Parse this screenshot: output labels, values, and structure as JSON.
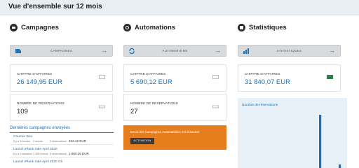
{
  "header": {
    "title": "Vue d'ensemble sur 12 mois"
  },
  "campagnes": {
    "title": "Campagnes",
    "button_label": "CAMPAGNES",
    "revenue": {
      "label": "CHIFFRE D'AFFAIRES",
      "value": "26 149,95 EUR"
    },
    "bookings": {
      "label": "NOMBRE DE RÉSERVATIONS",
      "value": "109"
    },
    "recent": {
      "title": "Dernières campagnes envoyées",
      "rows": [
        {
          "name": "Courrier Beo",
          "age": "Il y a 3 heures",
          "sent": "2 envois",
          "reservations": "3 réservations",
          "amount": "452,22 EUR"
        },
        {
          "name": "Launch Plank Sale April 2020",
          "age": "Il y a 1 semaine",
          "sent": "1 355 envois",
          "reservations": "3 réservations",
          "amount": "1 860,36 EUR"
        },
        {
          "name": "Launch Plank Sale April 2020 Gli",
          "age": "",
          "sent": "",
          "reservations": "",
          "amount": ""
        }
      ]
    }
  },
  "automations": {
    "title": "Automations",
    "button_label": "AUTOMATIONS",
    "revenue": {
      "label": "CHIFFRE D'AFFAIRES",
      "value": "5 690,12 EUR"
    },
    "bookings": {
      "label": "NOMBRE DE RÉSERVATIONS",
      "value": "27"
    },
    "banner": {
      "text": "Envoi des Campagnes Automatisées est désactivé",
      "button_label": "ACTIVATION"
    }
  },
  "statistiques": {
    "title": "Statistiques",
    "button_label": "STATISTIQUES",
    "revenue": {
      "label": "CHIFFRE D'AFFAIRES",
      "value": "31 840,07 EUR"
    },
    "chart_title": "Nombre de réservations"
  },
  "chart_data": {
    "type": "bar",
    "title": "Nombre de réservations",
    "values": [
      0,
      0,
      0,
      0,
      0,
      0,
      0,
      0,
      0,
      0,
      0,
      0,
      0,
      0,
      0,
      0,
      0,
      0,
      0,
      0,
      0,
      0,
      0,
      0,
      0,
      0,
      0,
      0,
      74,
      0,
      0,
      0,
      0,
      0,
      0,
      5,
      0
    ],
    "color": "#1b72b8"
  },
  "colors": {
    "accent": "#1b72b8",
    "banner": "#e67e1e",
    "header_bg": "#e9eef2"
  }
}
